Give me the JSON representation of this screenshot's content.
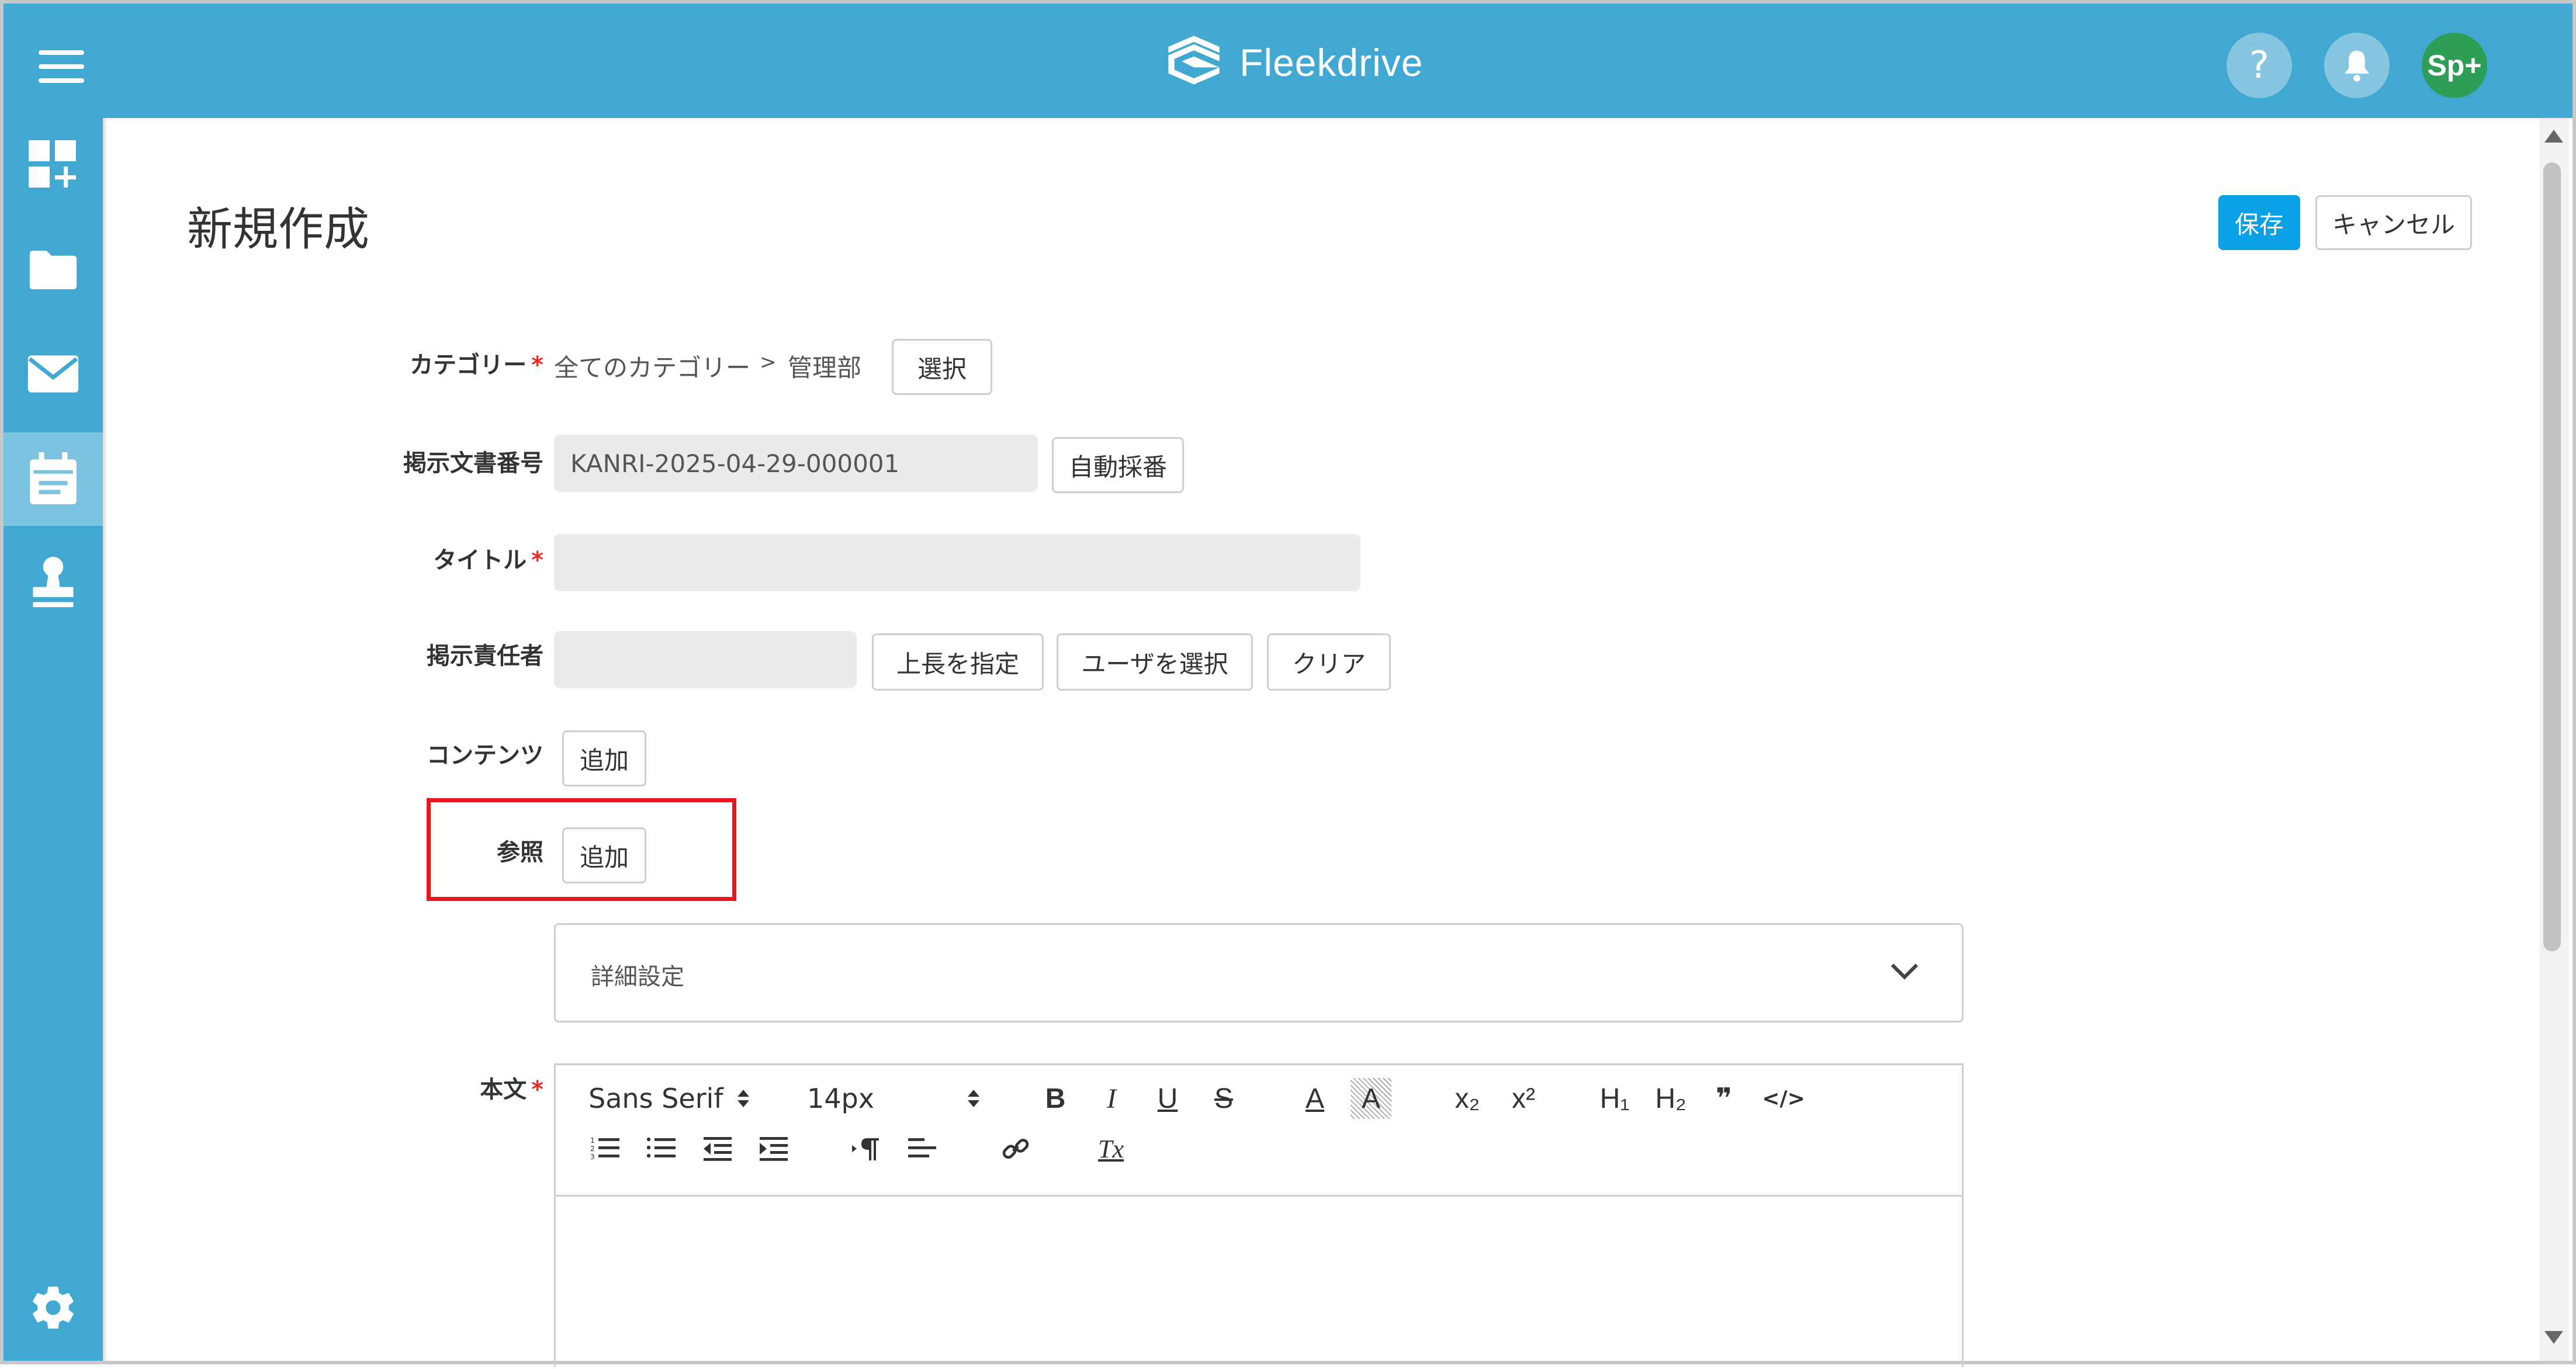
{
  "header": {
    "app_name": "Fleekdrive",
    "help_symbol": "?",
    "avatar_text": "Sp+",
    "color": "#41a8d2"
  },
  "sidebar": {
    "items": [
      {
        "icon": "dashboard-add-icon",
        "active": false
      },
      {
        "icon": "folder-icon",
        "active": false
      },
      {
        "icon": "mail-icon",
        "active": false
      },
      {
        "icon": "calendar-board-icon",
        "active": true
      },
      {
        "icon": "stamp-icon",
        "active": false
      },
      {
        "icon": "gear-icon",
        "active": false
      }
    ]
  },
  "page": {
    "title": "新規作成",
    "save_label": "保存",
    "cancel_label": "キャンセル",
    "accent": "#0aa0e6"
  },
  "form": {
    "category": {
      "label": "カテゴリー",
      "required": "*",
      "path_root": "全てのカテゴリー",
      "separator": ">",
      "path_leaf": "管理部",
      "select_label": "選択"
    },
    "doc_number": {
      "label": "掲示文書番号",
      "value": "KANRI-2025-04-29-000001",
      "auto_label": "自動採番"
    },
    "title": {
      "label": "タイトル",
      "required": "*",
      "value": ""
    },
    "owner": {
      "label": "掲示責任者",
      "value": "",
      "boss_label": "上長を指定",
      "user_label": "ユーザを選択",
      "clear_label": "クリア"
    },
    "contents": {
      "label": "コンテンツ",
      "add_label": "追加"
    },
    "reference": {
      "label": "参照",
      "add_label": "追加",
      "highlight_color": "#e5161c"
    },
    "advanced": {
      "label": "詳細設定"
    },
    "body": {
      "label": "本文",
      "required": "*"
    }
  },
  "editor": {
    "font_family": "Sans Serif",
    "font_size": "14px",
    "bold": "B",
    "italic": "I",
    "underline": "U",
    "strike": "S",
    "text_color": "A",
    "background_color": "A",
    "subscript": "x₂",
    "superscript": "x²",
    "h1": "H₁",
    "h2": "H₂",
    "quote": "❞",
    "code": "</>",
    "clear_format": "Tx"
  }
}
